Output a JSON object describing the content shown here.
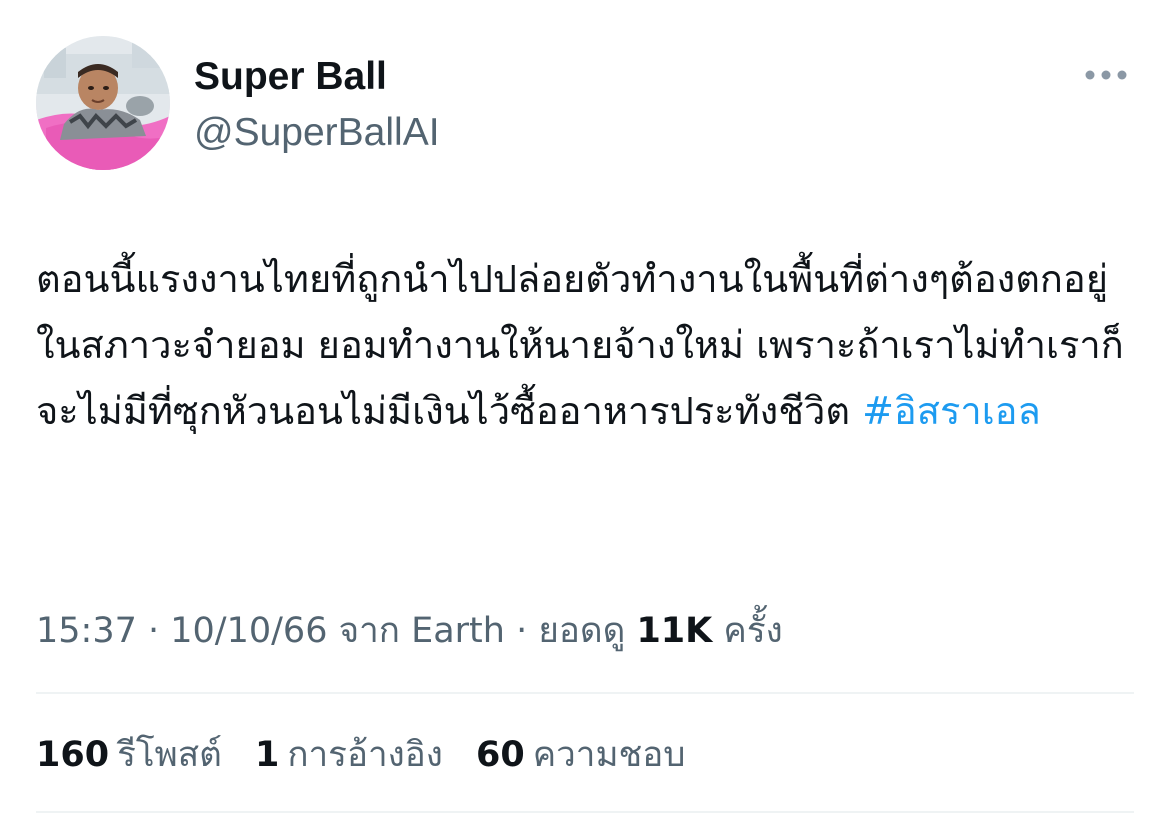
{
  "user": {
    "display_name": "Super Ball",
    "handle": "@SuperBallAI",
    "avatar_icon": "user-avatar-photo"
  },
  "more_icon": "more-horizontal-icon",
  "tweet": {
    "text": "ตอนนี้แรงงานไทยที่ถูกนำไปปล่อยตัวทำงานในพื้นที่ต่างๆต้องตกอยู่ในสภาวะจำยอม ยอมทำงานให้นายจ้างใหม่ เพราะถ้าเราไม่ทำเราก็จะไม่มีที่ซุกหัวนอนไม่มีเงินไว้ซื้ออาหารประทังชีวิต",
    "hashtag": "#อิสราเอล",
    "hashtag_color": "#1d9bf0"
  },
  "meta": {
    "time": "15:37",
    "separator1": " · ",
    "date": "10/10/66",
    "source_prefix": " จาก ",
    "source": "Earth",
    "separator2": " · ",
    "views_prefix": "ยอดดู ",
    "views_count": "11K",
    "views_suffix": " ครั้ง"
  },
  "stats": {
    "retweets": {
      "count": "160",
      "label": "รีโพสต์"
    },
    "quotes": {
      "count": "1",
      "label": "การอ้างอิง"
    },
    "likes": {
      "count": "60",
      "label": "ความชอบ"
    }
  },
  "colors": {
    "text_primary": "#0f1419",
    "text_secondary": "#536471",
    "divider": "#eff3f4",
    "link": "#1d9bf0"
  }
}
